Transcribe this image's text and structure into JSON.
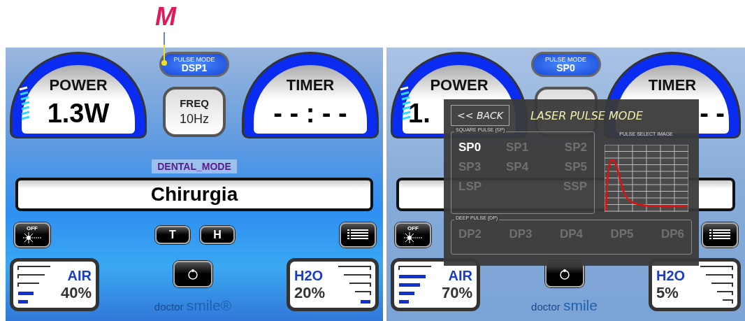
{
  "annotation": {
    "label": "M"
  },
  "screens": [
    {
      "pulse_mode": {
        "label": "PULSE MODE",
        "value": "DSP1"
      },
      "power": {
        "label": "POWER",
        "value": "1.3W"
      },
      "freq": {
        "label": "FREQ",
        "value": "10Hz"
      },
      "timer": {
        "label": "TIMER",
        "value": "- - : - -"
      },
      "mode_label": "DENTAL_MODE",
      "mode_value": "Chirurgia",
      "light_button": "OFF",
      "tool_buttons": [
        "T",
        "H"
      ],
      "air": {
        "label": "AIR",
        "value": "40%",
        "bars": [
          {
            "filled": false
          },
          {
            "filled": false
          },
          {
            "filled": false
          },
          {
            "filled": true
          },
          {
            "filled": true
          }
        ]
      },
      "h2o": {
        "label": "H2O",
        "value": "20%",
        "bars": [
          {
            "filled": false
          },
          {
            "filled": false
          },
          {
            "filled": false
          },
          {
            "filled": false
          },
          {
            "filled": true
          }
        ]
      },
      "logo": {
        "word": "doctor",
        "brand": "smile®"
      }
    },
    {
      "pulse_mode": {
        "label": "PULSE MODE",
        "value": "SP0"
      },
      "power": {
        "label": "POWER",
        "value": "1."
      },
      "timer": {
        "label": "TIMER",
        "value": "- -"
      },
      "light_button": "OFF",
      "air": {
        "label": "AIR",
        "value": "70%",
        "bars": [
          {
            "filled": false
          },
          {
            "filled": true
          },
          {
            "filled": true
          },
          {
            "filled": true
          },
          {
            "filled": true
          }
        ]
      },
      "h2o": {
        "label": "H2O",
        "value": "5%",
        "bars": [
          {
            "filled": false
          },
          {
            "filled": false
          },
          {
            "filled": false
          },
          {
            "filled": false
          },
          {
            "filled": false
          }
        ]
      },
      "logo": {
        "word": "doctor",
        "brand": "smile"
      },
      "overlay": {
        "back_button": "<< BACK",
        "title": "LASER PULSE MODE",
        "square_group": {
          "label": "SQUARE PULSE (SP)",
          "rows": [
            [
              {
                "label": "SP0",
                "selected": true
              },
              {
                "label": "SP1",
                "selected": false
              },
              {
                "label": "SP2",
                "selected": false
              }
            ],
            [
              {
                "label": "SP3",
                "selected": false
              },
              {
                "label": "SP4",
                "selected": false
              },
              {
                "label": "SP5",
                "selected": false
              }
            ],
            [
              {
                "label": "LSP",
                "selected": false
              },
              null,
              {
                "label": "SSP",
                "selected": false
              }
            ]
          ]
        },
        "image_title": "PULSE SELECT IMAGE",
        "deep_group": {
          "label": "DEEP PULSE (DP)",
          "items": [
            {
              "label": "DP2",
              "selected": false
            },
            {
              "label": "DP3",
              "selected": false
            },
            {
              "label": "DP4",
              "selected": false
            },
            {
              "label": "DP5",
              "selected": false
            },
            {
              "label": "DP6",
              "selected": false
            }
          ]
        }
      }
    }
  ]
}
